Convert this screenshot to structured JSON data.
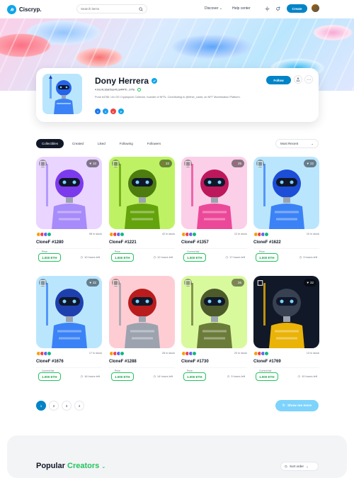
{
  "header": {
    "brand": "Ciscryp.",
    "search_placeholder": "Search items",
    "nav": [
      "Discover",
      "Help center"
    ],
    "create_label": "Create"
  },
  "profile": {
    "name": "Dony Herrera",
    "address": "4.0xc4c16ab5ac41ca4f47b...b7fa",
    "bio": "Punk #4786 / An OG Cryptopunk Collector, hoarder of NFTs. Contributing to @ether_cards, an NFT Monetization Platform.",
    "follow_label": "Follow",
    "socials": [
      "facebook",
      "twitter",
      "youtube",
      "telegram"
    ]
  },
  "tabs": [
    "Collectibles",
    "Created",
    "Liked",
    "Following",
    "Followers"
  ],
  "active_tab": "Collectibles",
  "sort_label": "Most Recent",
  "cards": [
    {
      "name": "CloneF #1280",
      "stock": "98 in stock",
      "likes": "10",
      "price_label": "Price",
      "price": "1.000 ETH",
      "time": "10 hours left",
      "bg": "#e9d5ff",
      "body": "#a78bfa",
      "head": "#7c3aed",
      "liked": false
    },
    {
      "name": "CloneF #1221",
      "stock": "42 in stock",
      "likes": "22",
      "price_label": "Price",
      "price": "1.000 ETH",
      "time": "12 hours left",
      "bg": "#bef264",
      "body": "#65a30d",
      "head": "#4d7c0f",
      "liked": true
    },
    {
      "name": "CloneF #1357",
      "stock": "12 in stock",
      "likes": "25",
      "price_label": "Current bid",
      "price": "1.000 ETH",
      "time": "17 hours left",
      "bg": "#fbcfe8",
      "body": "#ec4899",
      "head": "#be185d",
      "liked": true
    },
    {
      "name": "CloneF #1622",
      "stock": "10 in stock",
      "likes": "22",
      "price_label": "Price",
      "price": "1.000 ETH",
      "time": "3 hours left",
      "bg": "#bae6fd",
      "body": "#3b82f6",
      "head": "#1d4ed8",
      "liked": false
    },
    {
      "name": "CloneF #1676",
      "stock": "17 in stock",
      "likes": "32",
      "price_label": "Current bid",
      "price": "1.000 ETH",
      "time": "16 hours left",
      "bg": "#bae6fd",
      "body": "#3b82f6",
      "head": "#1e40af",
      "liked": false
    },
    {
      "name": "CloneF #1288",
      "stock": "28 in stock",
      "likes": "",
      "price_label": "Price",
      "price": "1.000 ETH",
      "time": "14 hours left",
      "bg": "#fecdd3",
      "body": "#9ca3af",
      "head": "#b91c1c",
      "liked": false
    },
    {
      "name": "CloneF #1730",
      "stock": "20 in stock",
      "likes": "26",
      "price_label": "Price",
      "price": "1.000 ETH",
      "time": "3 hours left",
      "bg": "#d9f99d",
      "body": "#6b7c3a",
      "head": "#4d5a2a",
      "liked": true
    },
    {
      "name": "CloneF #1769",
      "stock": "13 in stock",
      "likes": "32",
      "price_label": "Current bid",
      "price": "1.000 ETH",
      "time": "10 hours left",
      "bg": "#111827",
      "body": "#eab308",
      "head": "#374151",
      "liked": false
    }
  ],
  "pagination": [
    "1",
    "2",
    "3",
    "4"
  ],
  "show_more_label": "Show me more",
  "bottom": {
    "title_plain": "Popular",
    "title_accent": "Creators",
    "sort_label": "Sort order"
  }
}
